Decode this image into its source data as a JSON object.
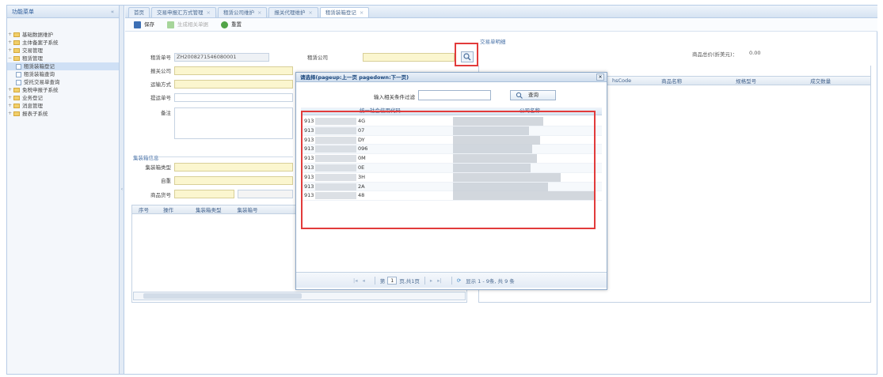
{
  "sidebar": {
    "header": "功能菜单",
    "items": [
      {
        "label": "基础数据维护",
        "level": 0
      },
      {
        "label": "主体备案子系统",
        "level": 0
      },
      {
        "label": "交易管理",
        "level": 0
      },
      {
        "label": "租赁管理",
        "level": 0
      },
      {
        "label": "租赁装箱登记",
        "level": 1
      },
      {
        "label": "租赁装箱查询",
        "level": 1
      },
      {
        "label": "受托交易单查询",
        "level": 1
      },
      {
        "label": "免税申报子系统",
        "level": 0
      },
      {
        "label": "业务登记",
        "level": 0
      },
      {
        "label": "消息管理",
        "level": 0
      },
      {
        "label": "报表子系统",
        "level": 0
      }
    ]
  },
  "tabs": [
    "首页",
    "交易申报汇方式管理",
    "租赁公司维护",
    "报关代理维护",
    "租赁装箱登记"
  ],
  "toolbar": {
    "save": "保存",
    "generate": "生成相关单据",
    "reset": "重置"
  },
  "form": {
    "lease_no_label": "租赁单号",
    "lease_no_value": "ZH2008271546080001",
    "lease_company_label": "租赁公司",
    "customs_company_label": "报关公司",
    "transport_label": "运输方式",
    "bill_no_label": "提运单号",
    "remark_label": "备注",
    "trade_details_label": "交易单明细",
    "container_group_title": "集装箱信息",
    "container_type_label": "集装箱类型",
    "tare_label": "自重",
    "goods_no_label": "商品货号",
    "total_price_label": "商品总价(折美元)：",
    "total_price_value": "0.00"
  },
  "container_grid": {
    "columns": [
      "序号",
      "操作",
      "集装箱类型",
      "集装箱号"
    ]
  },
  "detail_grid": {
    "columns": [
      "hsCode",
      "商品名称",
      "规格型号",
      "成交数量"
    ]
  },
  "modal": {
    "title": "请选择(pageup:上一页 pagedown:下一页)",
    "filter_label": "输入相关条件过滤",
    "filter_placeholder": "",
    "query_button": "查询",
    "col_code": "统一社会信用代码",
    "col_name": "公司名称",
    "rows": [
      {
        "prefix": "913",
        "suffix": "4G"
      },
      {
        "prefix": "913",
        "suffix": "07"
      },
      {
        "prefix": "913",
        "suffix": "DY"
      },
      {
        "prefix": "913",
        "suffix": "096"
      },
      {
        "prefix": "913",
        "suffix": "0M"
      },
      {
        "prefix": "913",
        "suffix": "0E"
      },
      {
        "prefix": "913",
        "suffix": "3H"
      },
      {
        "prefix": "913",
        "suffix": "2A"
      },
      {
        "prefix": "913",
        "suffix": "48"
      }
    ],
    "pager": {
      "page_prefix": "第",
      "page_value": "1",
      "page_suffix": "页,共1页",
      "summary": "显示 1 - 9条, 共 9 条"
    }
  },
  "colors": {
    "highlight": "#e23b3b",
    "required_field": "#fbf6cf",
    "accent": "#17447b"
  }
}
